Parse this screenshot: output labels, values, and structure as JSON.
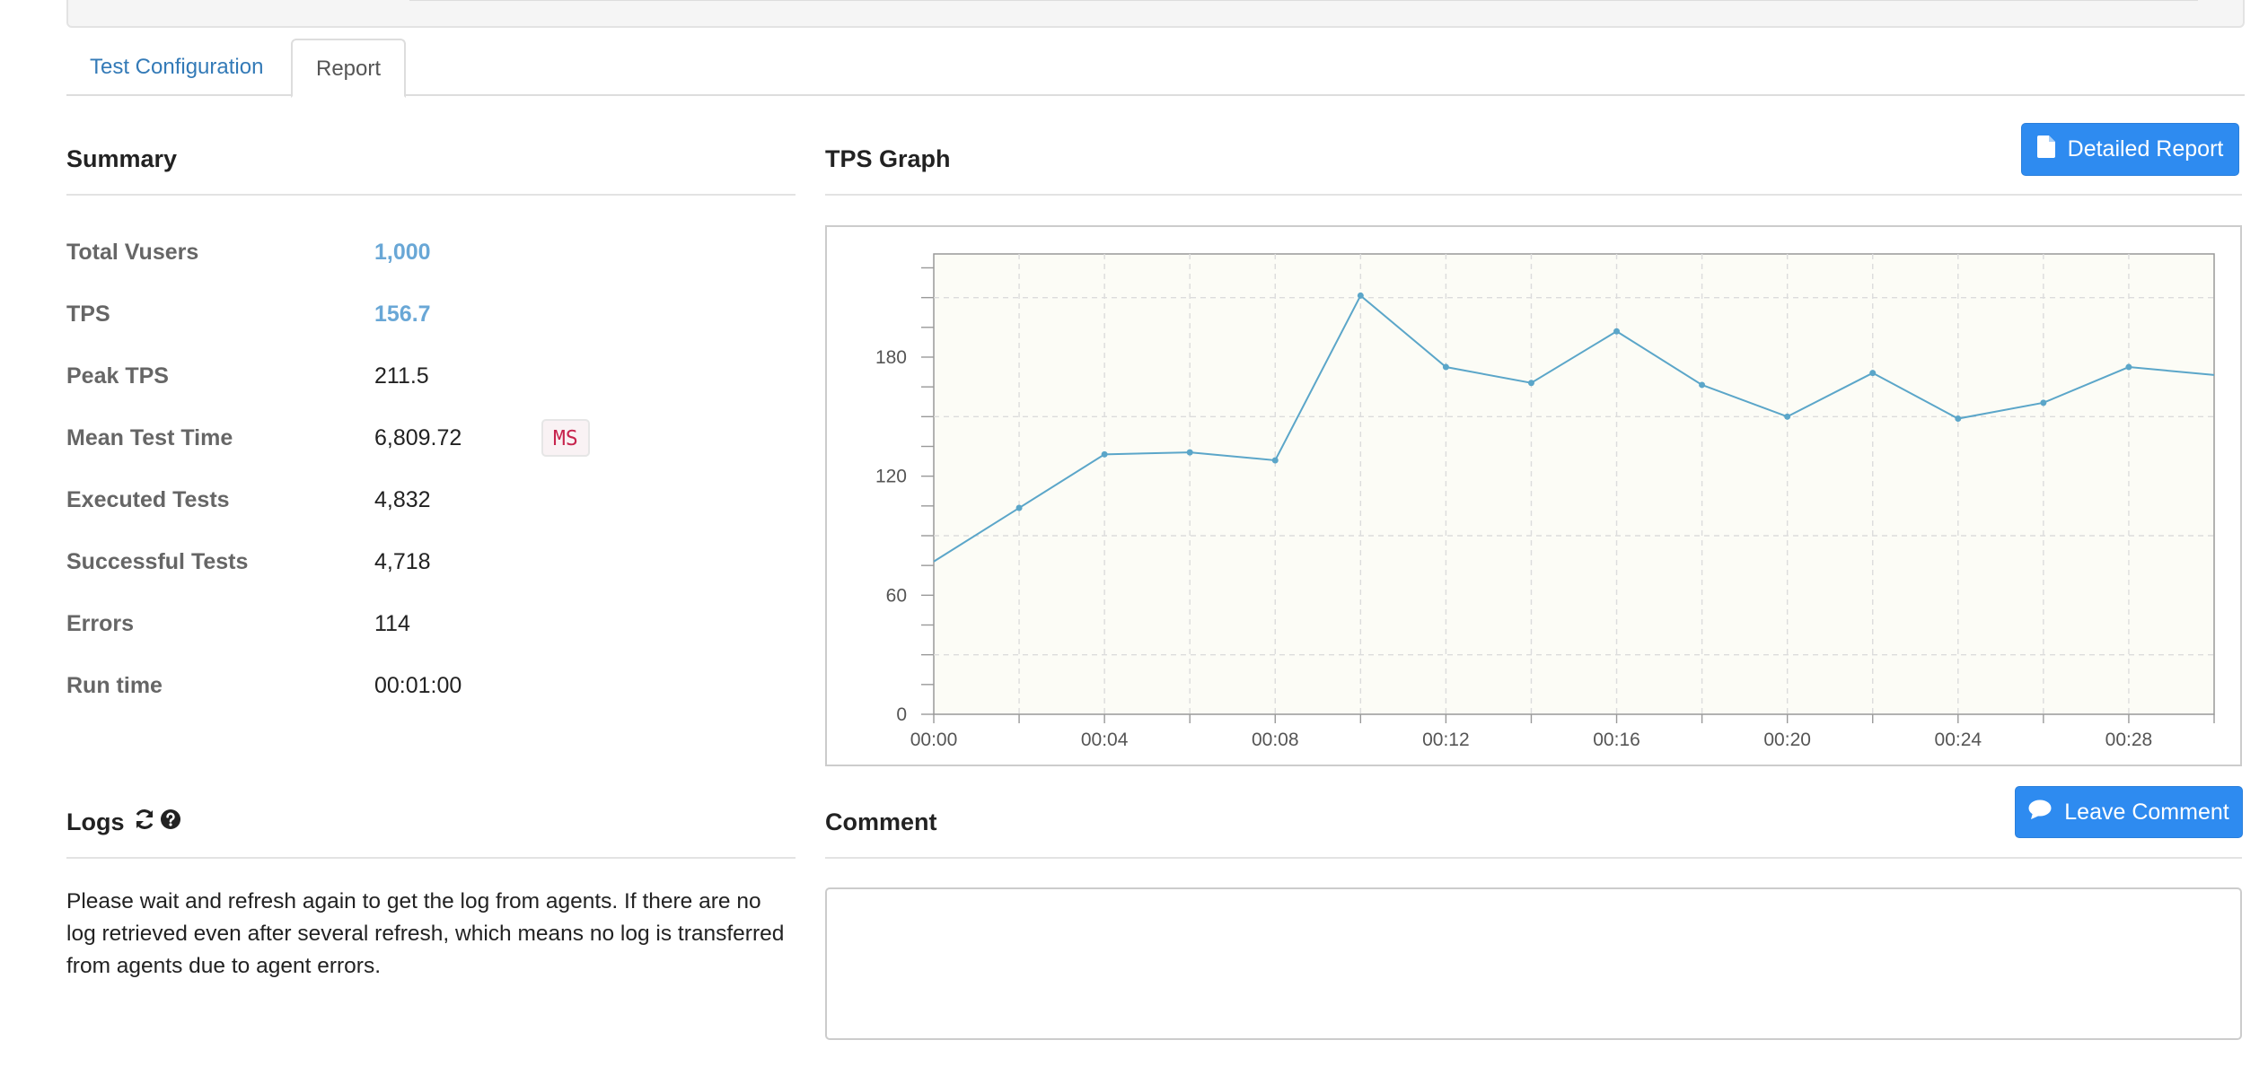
{
  "tabs": [
    {
      "label": "Test Configuration"
    },
    {
      "label": "Report"
    }
  ],
  "summary": {
    "title": "Summary",
    "rows": [
      {
        "label": "Total Vusers",
        "value": "1,000"
      },
      {
        "label": "TPS",
        "value": "156.7"
      },
      {
        "label": "Peak TPS",
        "value": "211.5"
      },
      {
        "label": "Mean Test Time",
        "value": "6,809.72",
        "unit": "MS"
      },
      {
        "label": "Executed Tests",
        "value": "4,832"
      },
      {
        "label": "Successful Tests",
        "value": "4,718"
      },
      {
        "label": "Errors",
        "value": "114"
      },
      {
        "label": "Run time",
        "value": "00:01:00"
      }
    ]
  },
  "tps_graph": {
    "title": "TPS Graph",
    "detailed_report_label": "Detailed Report"
  },
  "logs": {
    "title": "Logs",
    "message": "Please wait and refresh again to get the log from agents. If there are no log retrieved even after several refresh, which means no log is transferred from agents due to agent errors."
  },
  "comment": {
    "title": "Comment",
    "leave_comment_label": "Leave Comment",
    "value": ""
  },
  "colors": {
    "link": "#337ab7",
    "value_link": "#69a7d6",
    "button": "#2e8bf0",
    "line": "#5ba6c9",
    "plot_bg": "#fcfcf6"
  },
  "icons": [
    "file-icon",
    "refresh-icon",
    "question-circle-icon",
    "comment-icon"
  ],
  "chart_data": {
    "type": "line",
    "x": [
      "00:00",
      "00:02",
      "00:04",
      "00:06",
      "00:08",
      "00:10",
      "00:12",
      "00:14",
      "00:16",
      "00:18",
      "00:20",
      "00:22",
      "00:24",
      "00:26",
      "00:28",
      "00:30"
    ],
    "x_tick_labels": [
      "00:00",
      "00:04",
      "00:08",
      "00:12",
      "00:16",
      "00:20",
      "00:24",
      "00:28"
    ],
    "y_tick_labels": [
      "0",
      "60",
      "120",
      "180"
    ],
    "series": [
      {
        "values": [
          77,
          104,
          131,
          132,
          128,
          211,
          175,
          167,
          193,
          166,
          150,
          172,
          149,
          157,
          175,
          171
        ]
      }
    ],
    "ylim": [
      0,
      232
    ],
    "grid": true
  }
}
